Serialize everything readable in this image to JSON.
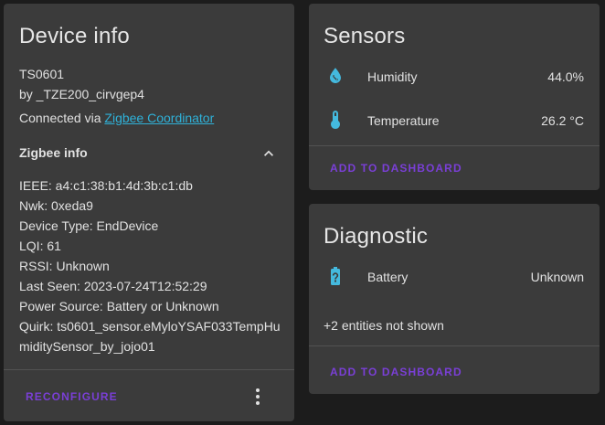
{
  "device_card": {
    "title": "Device info",
    "model": "TS0601",
    "manufacturer": "by _TZE200_cirvgep4",
    "connected_via_prefix": "Connected via",
    "connected_via_link": "Zigbee Coordinator",
    "zigbee_section_title": "Zigbee info",
    "zigbee_lines": [
      "IEEE: a4:c1:38:b1:4d:3b:c1:db",
      "Nwk: 0xeda9",
      "Device Type: EndDevice",
      "LQI: 61",
      "RSSI: Unknown",
      "Last Seen: 2023-07-24T12:52:29",
      "Power Source: Battery or Unknown",
      "Quirk: ts0601_sensor.eMyloYSAF033TempHu",
      "miditySensor_by_jojo01"
    ],
    "reconfigure_label": "RECONFIGURE",
    "icons": {
      "collapse": "chevron-up-icon",
      "menu": "more-vert-icon"
    }
  },
  "sensors_card": {
    "title": "Sensors",
    "rows": [
      {
        "icon": "water-percent-icon",
        "label": "Humidity",
        "value": "44.0%"
      },
      {
        "icon": "thermometer-icon",
        "label": "Temperature",
        "value": "26.2 °C"
      }
    ],
    "add_label": "ADD TO DASHBOARD"
  },
  "diagnostic_card": {
    "title": "Diagnostic",
    "rows": [
      {
        "icon": "battery-unknown-icon",
        "label": "Battery",
        "value": "Unknown"
      }
    ],
    "hidden_entities": "+2 entities not shown",
    "add_label": "ADD TO DASHBOARD"
  },
  "colors": {
    "background": "#1c1c1c",
    "card": "#3b3b3b",
    "accent_blue": "#2fb1d8",
    "accent_purple": "#7a3fd6",
    "icon_blue": "#44b9de"
  }
}
